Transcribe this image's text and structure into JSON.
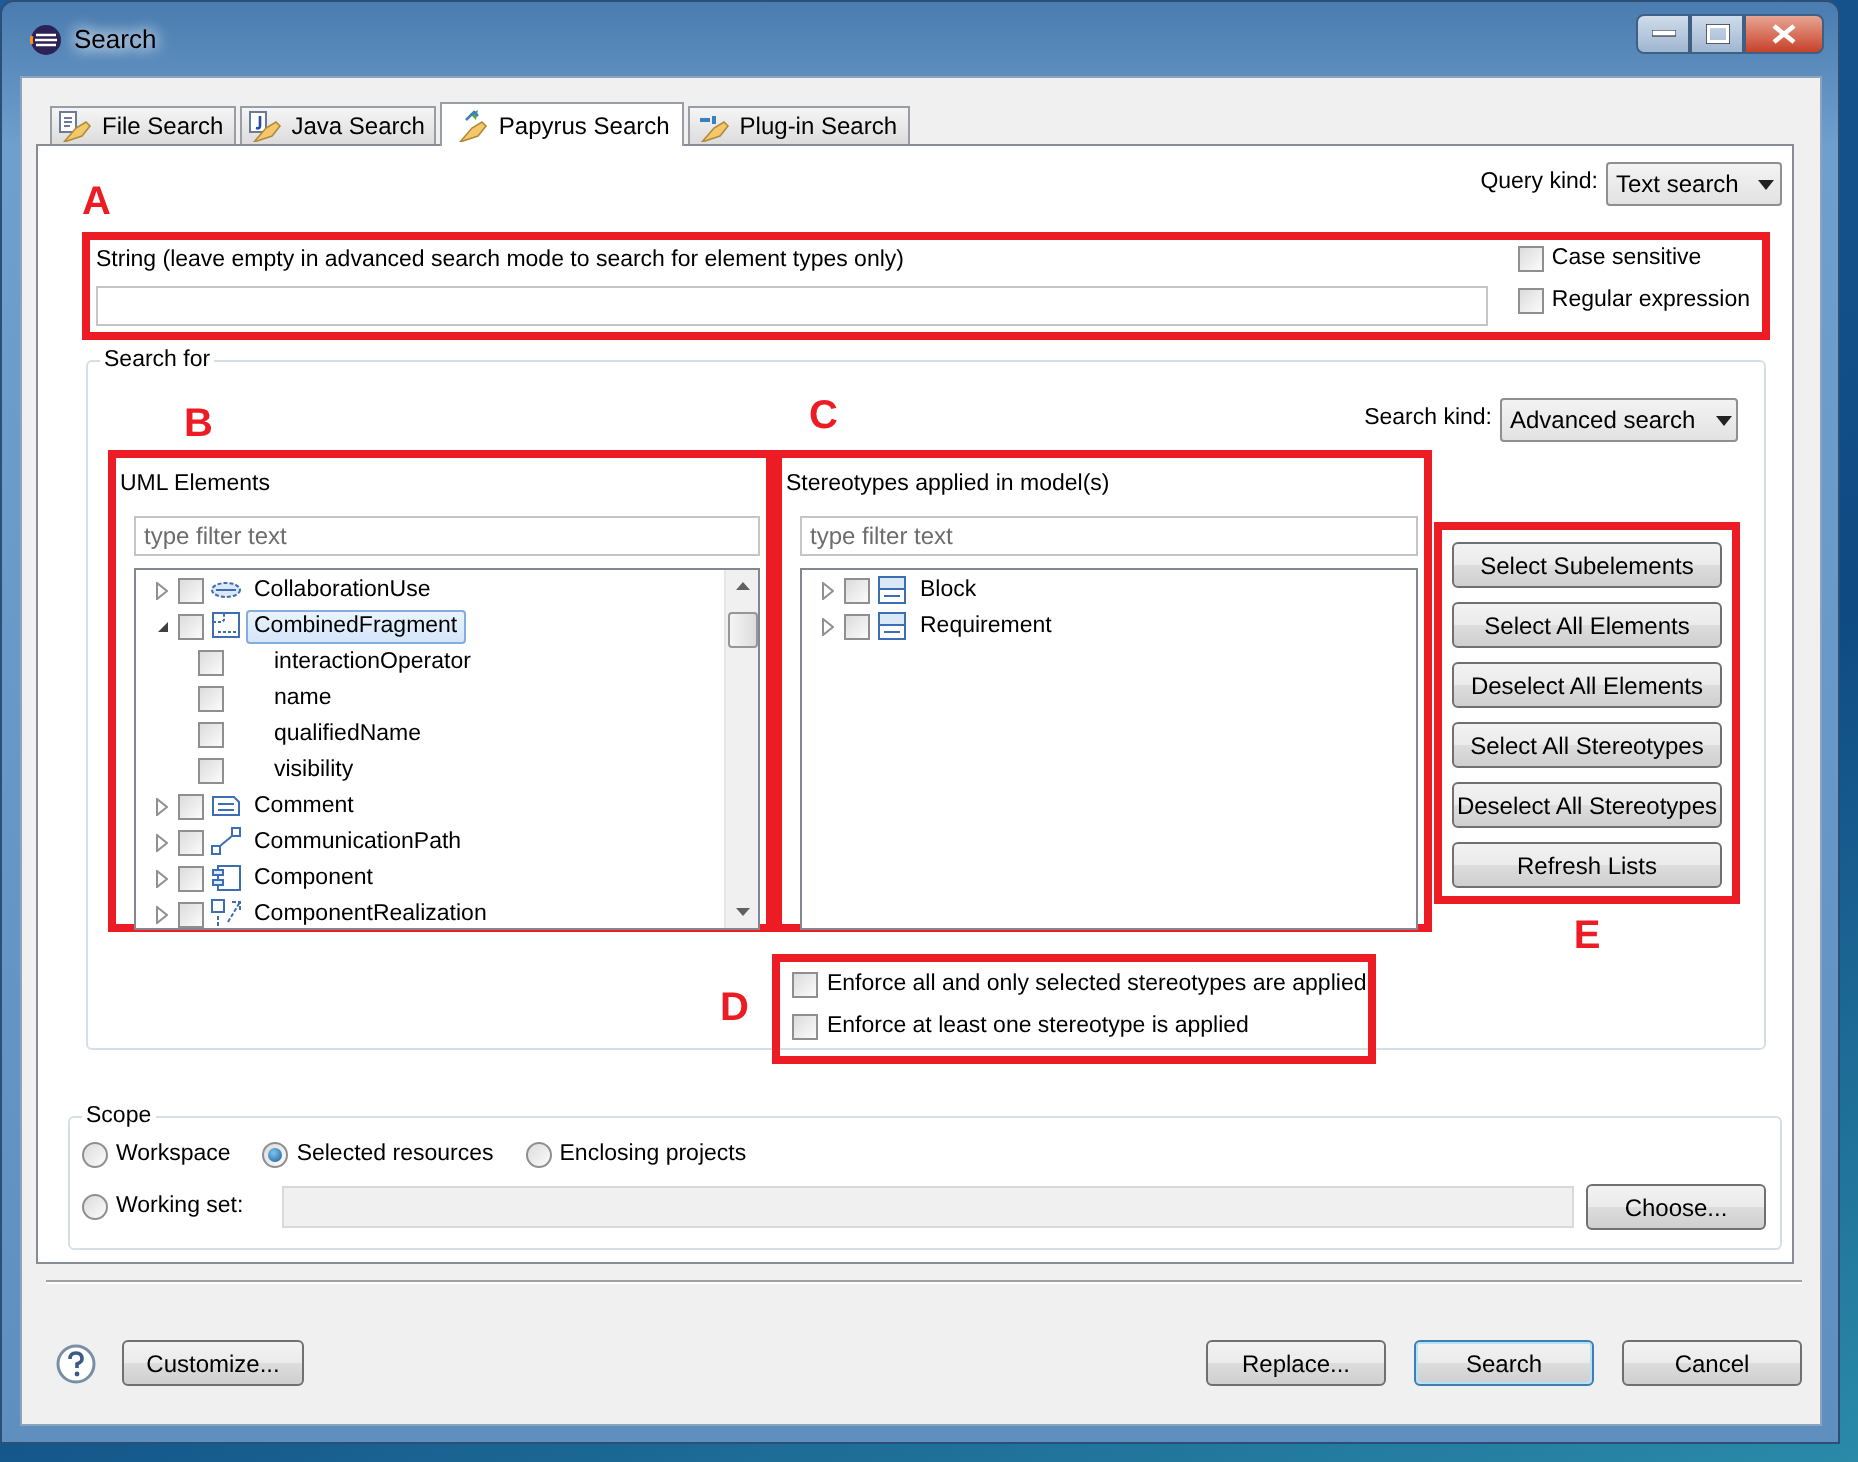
{
  "window": {
    "title": "Search"
  },
  "tabs": [
    {
      "label": "File Search",
      "selected": false
    },
    {
      "label": "Java Search",
      "selected": false
    },
    {
      "label": "Papyrus Search",
      "selected": true
    },
    {
      "label": "Plug-in Search",
      "selected": false
    }
  ],
  "query_kind": {
    "label": "Query kind:",
    "value": "Text search"
  },
  "string_section": {
    "annotation": "A",
    "label": "String (leave empty in advanced search mode to search for element types only)",
    "options": [
      {
        "label": "Case sensitive",
        "checked": false
      },
      {
        "label": "Regular expression",
        "checked": false
      }
    ]
  },
  "search_for": {
    "legend": "Search for",
    "search_kind": {
      "label": "Search kind:",
      "value": "Advanced search"
    },
    "uml_elements": {
      "annotation": "B",
      "title": "UML Elements",
      "filter_placeholder": "type filter text",
      "tree": [
        {
          "label": "CollaborationUse",
          "kind": "element",
          "expanded": false,
          "checked": false,
          "selected": false
        },
        {
          "label": "CombinedFragment",
          "kind": "element",
          "expanded": true,
          "checked": false,
          "selected": true,
          "children": [
            {
              "label": "interactionOperator",
              "kind": "attribute",
              "checked": false,
              "selected": false
            },
            {
              "label": "name",
              "kind": "attribute",
              "checked": false,
              "selected": false
            },
            {
              "label": "qualifiedName",
              "kind": "attribute",
              "checked": false,
              "selected": false
            },
            {
              "label": "visibility",
              "kind": "attribute",
              "checked": false,
              "selected": false
            }
          ]
        },
        {
          "label": "Comment",
          "kind": "element",
          "expanded": false,
          "checked": false,
          "selected": false
        },
        {
          "label": "CommunicationPath",
          "kind": "element",
          "expanded": false,
          "checked": false,
          "selected": false
        },
        {
          "label": "Component",
          "kind": "element",
          "expanded": false,
          "checked": false,
          "selected": false
        },
        {
          "label": "ComponentRealization",
          "kind": "element",
          "expanded": false,
          "checked": false,
          "selected": false
        }
      ]
    },
    "stereotypes": {
      "annotation": "C",
      "title": "Stereotypes applied in model(s)",
      "filter_placeholder": "type filter text",
      "tree": [
        {
          "label": "Block",
          "kind": "stereotype",
          "expanded": false,
          "checked": false,
          "selected": false
        },
        {
          "label": "Requirement",
          "kind": "stereotype",
          "expanded": false,
          "checked": false,
          "selected": false
        }
      ]
    },
    "enforce": {
      "annotation": "D",
      "options": [
        {
          "label": "Enforce all and only selected stereotypes are applied",
          "checked": false
        },
        {
          "label": "Enforce at least one stereotype is applied",
          "checked": false
        }
      ]
    },
    "actions": {
      "annotation": "E",
      "buttons": [
        "Select Subelements",
        "Select All Elements",
        "Deselect All Elements",
        "Select All Stereotypes",
        "Deselect All Stereotypes",
        "Refresh Lists"
      ]
    }
  },
  "scope": {
    "legend": "Scope",
    "options": [
      {
        "label": "Workspace",
        "selected": false
      },
      {
        "label": "Selected resources",
        "selected": true
      },
      {
        "label": "Enclosing projects",
        "selected": false
      }
    ],
    "working_set": {
      "label": "Working set:",
      "selected": false
    },
    "choose_button": "Choose..."
  },
  "footer": {
    "customize_button": "Customize...",
    "buttons": [
      {
        "label": "Replace...",
        "default": false
      },
      {
        "label": "Search",
        "default": true
      },
      {
        "label": "Cancel",
        "default": false
      }
    ]
  }
}
